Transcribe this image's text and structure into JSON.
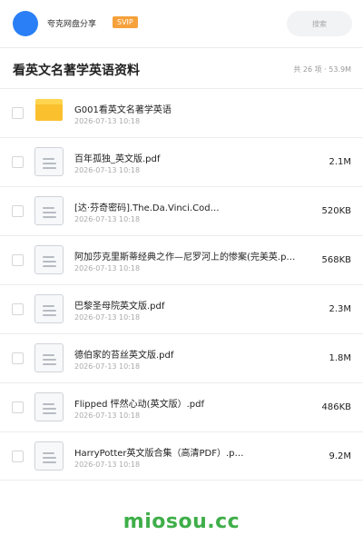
{
  "header": {
    "app_name": "夸克网盘分享",
    "badge": "SVIP",
    "search_placeholder": "搜索"
  },
  "folder": {
    "title": "看英文名著学英语资料",
    "summary_count": "共 26 项",
    "summary_separator": "·",
    "summary_size": "53.9M"
  },
  "items": [
    {
      "name": "G001看英文名著学英语",
      "date": "2026-07-13 10:18",
      "size": "",
      "type": "folder"
    },
    {
      "name": "百年孤独_英文版.pdf",
      "date": "2026-07-13 10:18",
      "size": "2.1M",
      "type": "file"
    },
    {
      "name": "[达·芬奇密码].The.Da.Vinci.Cod…",
      "date": "2026-07-13 10:18",
      "size": "520KB",
      "type": "file"
    },
    {
      "name": "阿加莎克里斯蒂经典之作—尼罗河上的惨案(完美英.p…",
      "date": "2026-07-13 10:18",
      "size": "568KB",
      "type": "file"
    },
    {
      "name": "巴黎圣母院英文版.pdf",
      "date": "2026-07-13 10:18",
      "size": "2.3M",
      "type": "file"
    },
    {
      "name": "德伯家的苔丝英文版.pdf",
      "date": "2026-07-13 10:18",
      "size": "1.8M",
      "type": "file"
    },
    {
      "name": "Flipped 怦然心动(英文版）.pdf",
      "date": "2026-07-13 10:18",
      "size": "486KB",
      "type": "file"
    },
    {
      "name": "HarryPotter英文版合集（高清PDF）.p…",
      "date": "2026-07-13 10:18",
      "size": "9.2M",
      "type": "file"
    }
  ],
  "watermark": "miosou.cc",
  "colors": {
    "avatar": "#2a7ff6",
    "badge": "#f6a13a",
    "folder": "#fbc02d",
    "watermark": "#3fae49"
  }
}
